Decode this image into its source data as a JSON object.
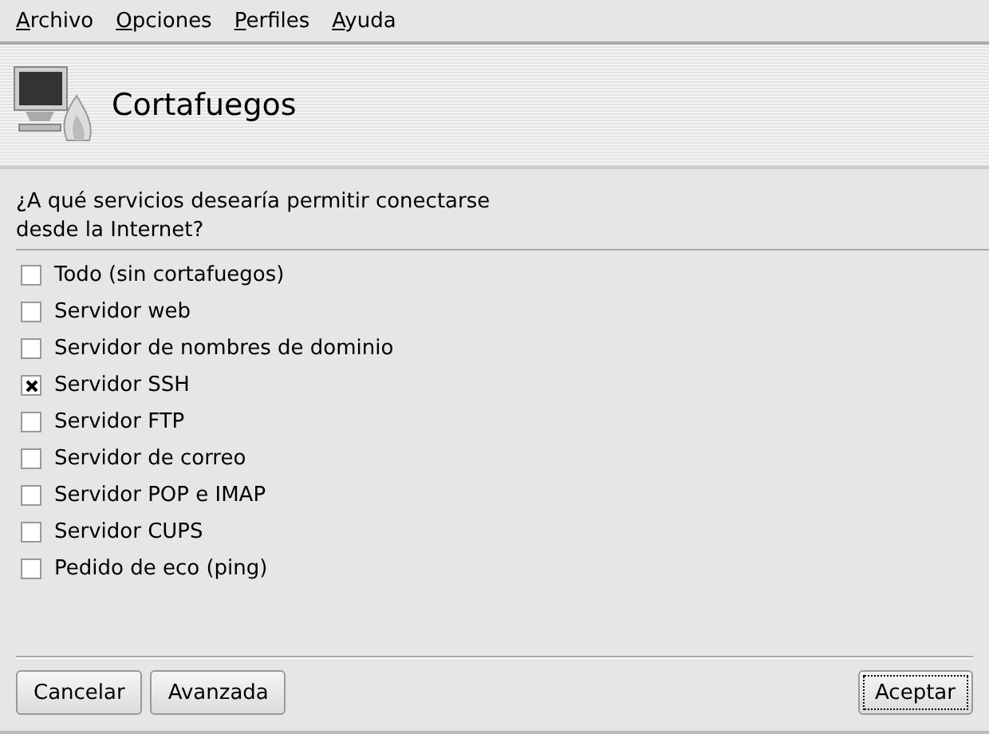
{
  "menu": [
    "Archivo",
    "Opciones",
    "Perfiles",
    "Ayuda"
  ],
  "header": {
    "title": "Cortafuegos"
  },
  "question": "¿A qué servicios desearía permitir conectarse desde la Internet?",
  "services": [
    {
      "label": "Todo (sin cortafuegos)",
      "checked": false
    },
    {
      "label": "Servidor web",
      "checked": false
    },
    {
      "label": "Servidor de nombres de dominio",
      "checked": false
    },
    {
      "label": "Servidor SSH",
      "checked": true
    },
    {
      "label": "Servidor FTP",
      "checked": false
    },
    {
      "label": "Servidor de correo",
      "checked": false
    },
    {
      "label": "Servidor POP e IMAP",
      "checked": false
    },
    {
      "label": "Servidor CUPS",
      "checked": false
    },
    {
      "label": "Pedido de eco (ping)",
      "checked": false
    }
  ],
  "buttons_left": [
    {
      "label": "Cancelar",
      "focused": false
    },
    {
      "label": "Avanzada",
      "focused": false
    }
  ],
  "buttons_right": [
    {
      "label": "Aceptar",
      "focused": true
    }
  ]
}
